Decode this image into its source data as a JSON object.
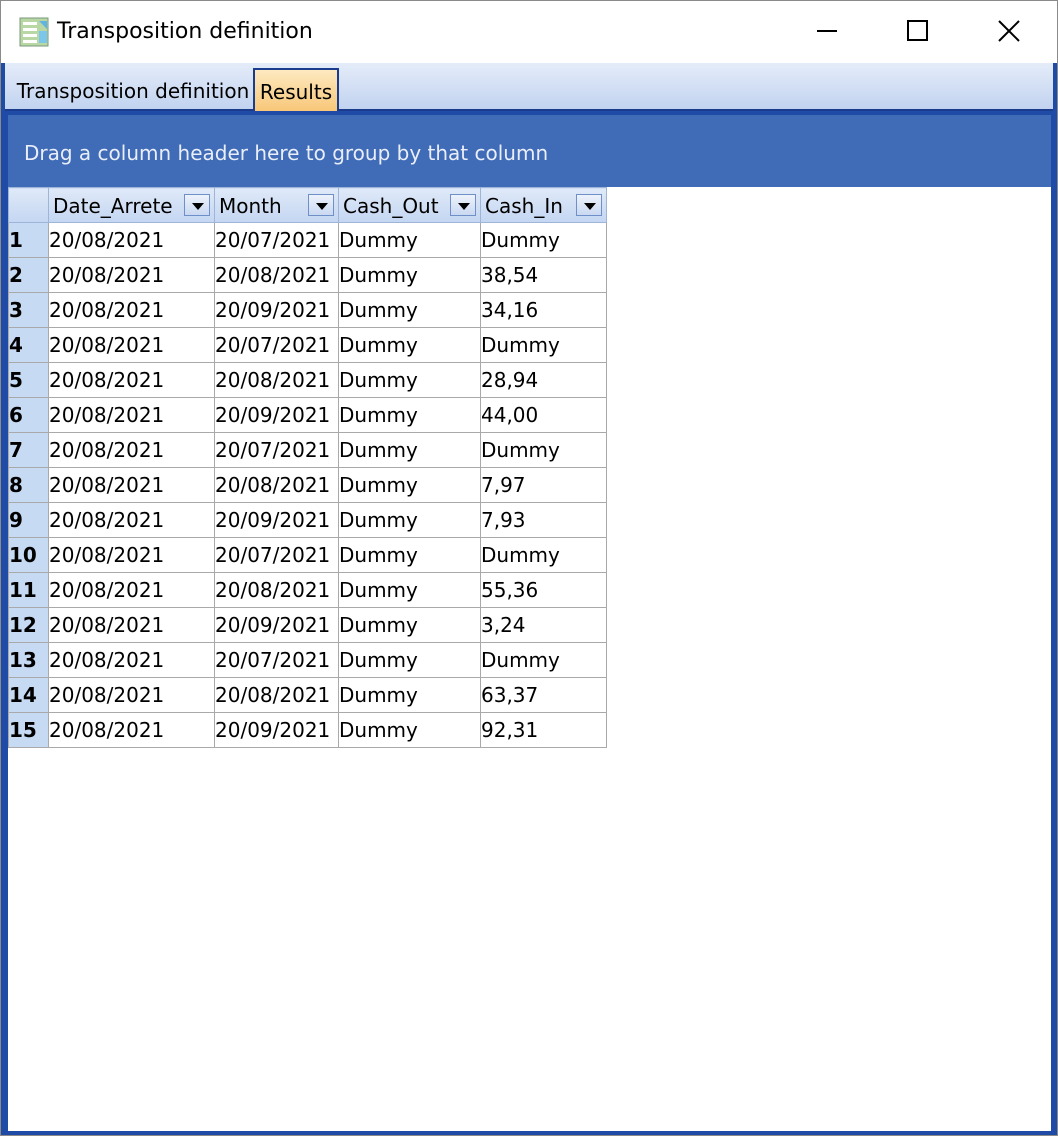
{
  "window": {
    "title": "Transposition definition"
  },
  "tabs": [
    {
      "label": "Transposition definition",
      "active": false
    },
    {
      "label": "Results",
      "active": true
    }
  ],
  "group_panel": {
    "text": "Drag a column header here to group by that column"
  },
  "grid": {
    "columns": [
      "Date_Arrete",
      "Month",
      "Cash_Out",
      "Cash_In"
    ],
    "rows": [
      {
        "n": "1",
        "cells": [
          "20/08/2021",
          "20/07/2021",
          "Dummy",
          "Dummy"
        ]
      },
      {
        "n": "2",
        "cells": [
          "20/08/2021",
          "20/08/2021",
          "Dummy",
          "38,54"
        ]
      },
      {
        "n": "3",
        "cells": [
          "20/08/2021",
          "20/09/2021",
          "Dummy",
          "34,16"
        ]
      },
      {
        "n": "4",
        "cells": [
          "20/08/2021",
          "20/07/2021",
          "Dummy",
          "Dummy"
        ]
      },
      {
        "n": "5",
        "cells": [
          "20/08/2021",
          "20/08/2021",
          "Dummy",
          "28,94"
        ]
      },
      {
        "n": "6",
        "cells": [
          "20/08/2021",
          "20/09/2021",
          "Dummy",
          "44,00"
        ]
      },
      {
        "n": "7",
        "cells": [
          "20/08/2021",
          "20/07/2021",
          "Dummy",
          "Dummy"
        ]
      },
      {
        "n": "8",
        "cells": [
          "20/08/2021",
          "20/08/2021",
          "Dummy",
          "7,97"
        ]
      },
      {
        "n": "9",
        "cells": [
          "20/08/2021",
          "20/09/2021",
          "Dummy",
          "7,93"
        ]
      },
      {
        "n": "10",
        "cells": [
          "20/08/2021",
          "20/07/2021",
          "Dummy",
          "Dummy"
        ]
      },
      {
        "n": "11",
        "cells": [
          "20/08/2021",
          "20/08/2021",
          "Dummy",
          "55,36"
        ]
      },
      {
        "n": "12",
        "cells": [
          "20/08/2021",
          "20/09/2021",
          "Dummy",
          "3,24"
        ]
      },
      {
        "n": "13",
        "cells": [
          "20/08/2021",
          "20/07/2021",
          "Dummy",
          "Dummy"
        ]
      },
      {
        "n": "14",
        "cells": [
          "20/08/2021",
          "20/08/2021",
          "Dummy",
          "63,37"
        ]
      },
      {
        "n": "15",
        "cells": [
          "20/08/2021",
          "20/09/2021",
          "Dummy",
          "92,31"
        ]
      }
    ]
  },
  "colors": {
    "frame_blue": "#1f4aa6",
    "group_panel": "#3f6bb7",
    "active_tab": "#f8c779",
    "row_header": "#c6daf4"
  },
  "icons": {
    "app": "app-icon",
    "minimize": "minimize-icon",
    "maximize": "maximize-icon",
    "close": "close-icon",
    "column_filter": "chevron-down-icon"
  }
}
